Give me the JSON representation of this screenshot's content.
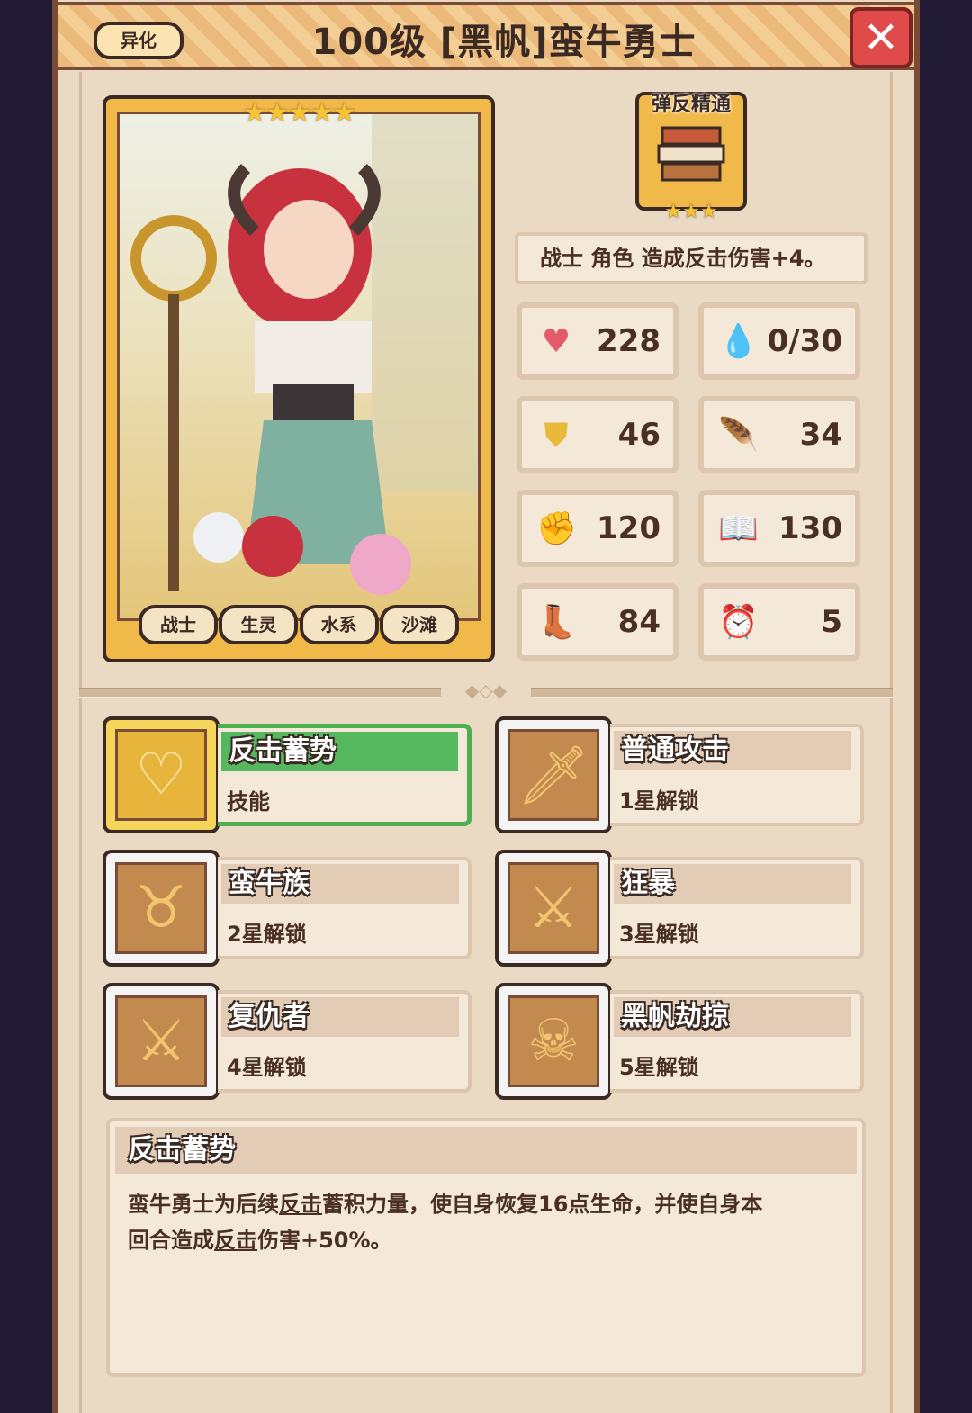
{
  "header": {
    "badge": "异化",
    "title": "100级 [黑帆]蛮牛勇士",
    "close": "✕"
  },
  "portrait": {
    "stars": "★★★★★",
    "tags": [
      "战士",
      "生灵",
      "水系",
      "沙滩"
    ]
  },
  "mastery": {
    "label": "弹反精通",
    "stars": "★★★",
    "description": "战士 角色 造成反击伤害+4。"
  },
  "stats": [
    {
      "icon": "heart-icon",
      "glyph": "♥",
      "color": "#e35a6a",
      "value": "228"
    },
    {
      "icon": "mana-drop-icon",
      "glyph": "💧",
      "color": "#4aa8e6",
      "value": "0/30"
    },
    {
      "icon": "shield-icon",
      "glyph": "⛊",
      "color": "#e9b93a",
      "value": "46"
    },
    {
      "icon": "wing-icon",
      "glyph": "🪶",
      "color": "#9fb6cf",
      "value": "34"
    },
    {
      "icon": "fist-icon",
      "glyph": "✊",
      "color": "#d5585a",
      "value": "120"
    },
    {
      "icon": "spellbook-icon",
      "glyph": "📖",
      "color": "#3f7fd1",
      "value": "130"
    },
    {
      "icon": "boot-icon",
      "glyph": "👢",
      "color": "#3f6fd1",
      "value": "84"
    },
    {
      "icon": "clock-icon",
      "glyph": "⏰",
      "color": "#e9b93a",
      "value": "5"
    }
  ],
  "skills": [
    {
      "name": "反击蓄势",
      "sub": "技能",
      "glyph": "♡",
      "active": true
    },
    {
      "name": "普通攻击",
      "sub": "1星解锁",
      "glyph": "🗡",
      "active": false
    },
    {
      "name": "蛮牛族",
      "sub": "2星解锁",
      "glyph": "♉",
      "active": false
    },
    {
      "name": "狂暴",
      "sub": "3星解锁",
      "glyph": "⚔",
      "active": false
    },
    {
      "name": "复仇者",
      "sub": "4星解锁",
      "glyph": "⚔",
      "active": false
    },
    {
      "name": "黑帆劫掠",
      "sub": "5星解锁",
      "glyph": "☠",
      "active": false
    }
  ],
  "detail": {
    "title": "反击蓄势",
    "line1_a": "蛮牛勇士为后续",
    "line1_link": "反击",
    "line1_b": "蓄积力量，使自身恢复16点生命，并使自身本",
    "line2_a": "回合造成",
    "line2_link": "反击",
    "line2_b": "伤害+50%。"
  }
}
